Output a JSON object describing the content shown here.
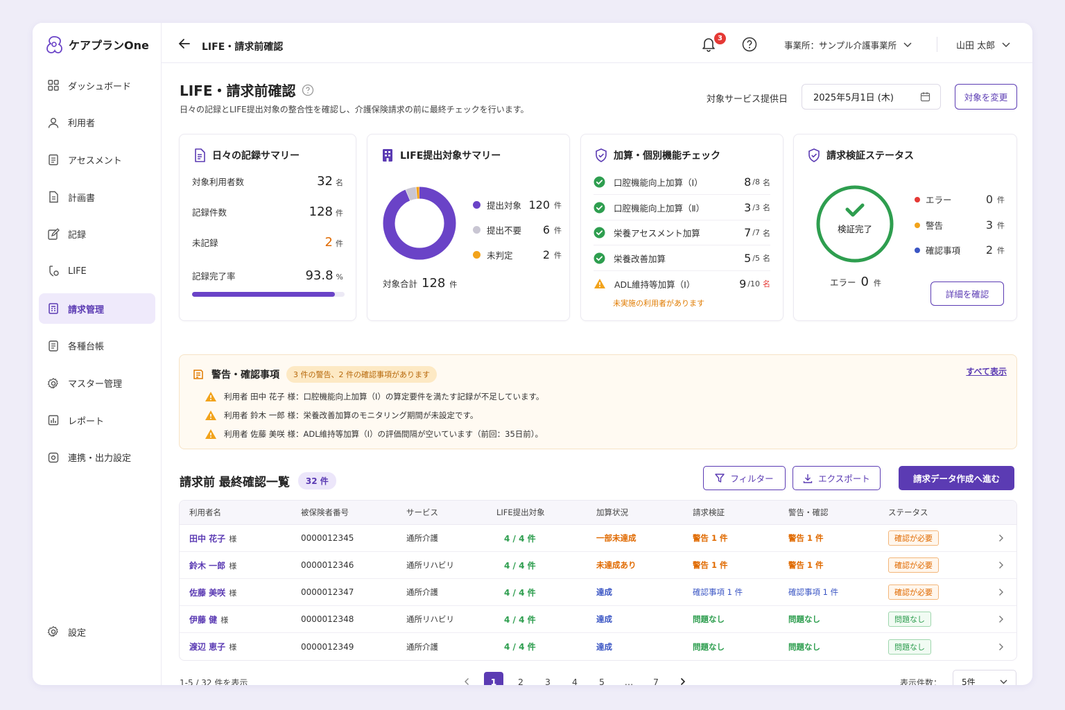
{
  "app": {
    "name": "ケアプランOne"
  },
  "header": {
    "title": "LIFE・請求前確認",
    "notification_count": "3",
    "office": "事業所：サンプル介護事業所",
    "user": "山田 太郎"
  },
  "sidebar": {
    "items": [
      {
        "label": "ダッシュボード",
        "icon": "grid-icon"
      },
      {
        "label": "利用者",
        "icon": "user-icon"
      },
      {
        "label": "アセスメント",
        "icon": "clipboard-icon"
      },
      {
        "label": "計画書",
        "icon": "document-icon"
      },
      {
        "label": "記録",
        "icon": "edit-icon"
      },
      {
        "label": "LIFE",
        "icon": "life-icon"
      },
      {
        "label": "請求管理",
        "icon": "billing-icon"
      },
      {
        "label": "各種台帳",
        "icon": "ledger-icon"
      },
      {
        "label": "マスター管理",
        "icon": "gear-icon"
      },
      {
        "label": "レポート",
        "icon": "report-icon"
      },
      {
        "label": "連携・出力設定",
        "icon": "link-settings-icon"
      }
    ],
    "active_index": 6,
    "bottom": {
      "label": "設定",
      "icon": "gear-icon"
    }
  },
  "page": {
    "title": "LIFE・請求前確認",
    "subtitle": "日々の記録とLIFE提出対象の整合性を確認し、介護保険請求の前に最終チェックを行います。",
    "date_label": "対象サービス提供日",
    "date_value": "2025年5月1日 (木)",
    "change_button": "対象を変更"
  },
  "records_card": {
    "title": "日々の記録サマリー",
    "rows": [
      {
        "label": "対象利用者数",
        "value": "32",
        "unit": "名"
      },
      {
        "label": "記録件数",
        "value": "128",
        "unit": "件"
      },
      {
        "label": "未記録",
        "value": "2",
        "unit": "件"
      },
      {
        "label": "記録完了率",
        "value": "93.8",
        "unit": "%"
      }
    ],
    "completion_fraction": 0.938
  },
  "life_card": {
    "title": "LIFE提出対象サマリー",
    "legend": [
      {
        "label": "提出対象",
        "value": "120",
        "unit": "件",
        "color": "#6a43c7"
      },
      {
        "label": "提出不要",
        "value": "6",
        "unit": "件",
        "color": "#c9c6d3"
      },
      {
        "label": "未判定",
        "value": "2",
        "unit": "件",
        "color": "#f2a31b"
      }
    ],
    "total_label": "対象合計",
    "total_value": "128",
    "total_unit": "件"
  },
  "kasan_card": {
    "title": "加算・個別機能チェック",
    "rows": [
      {
        "label": "口腔機能向上加算（Ⅰ）",
        "value": "8",
        "denom": "/8",
        "unit": "名",
        "status": "ok"
      },
      {
        "label": "口腔機能向上加算（Ⅱ）",
        "value": "3",
        "denom": "/3",
        "unit": "名",
        "status": "ok"
      },
      {
        "label": "栄養アセスメント加算",
        "value": "7",
        "denom": "/7",
        "unit": "名",
        "status": "ok"
      },
      {
        "label": "栄養改善加算",
        "value": "5",
        "denom": "/5",
        "unit": "名",
        "status": "ok"
      },
      {
        "label": "ADL維持等加算（Ⅰ）",
        "value": "9",
        "denom": "/10",
        "unit": "名",
        "status": "warn"
      }
    ],
    "warn_note": "未実施の利用者があります"
  },
  "status_card": {
    "title": "請求検証ステータス",
    "center_label": "検証完了",
    "error_label": "エラー",
    "error_value": "0",
    "error_unit": "件",
    "legend": [
      {
        "label": "エラー",
        "value": "0",
        "unit": "件",
        "color": "#e53935"
      },
      {
        "label": "警告",
        "value": "3",
        "unit": "件",
        "color": "#f2a31b"
      },
      {
        "label": "確認事項",
        "value": "2",
        "unit": "件",
        "color": "#3b56c4"
      }
    ],
    "detail_button": "詳細を確認"
  },
  "alerts": {
    "title": "警告・確認事項",
    "pill": "3 件の警告、2 件の確認事項があります",
    "show_all": "すべて表示",
    "items": [
      "利用者 田中 花子 様：口腔機能向上加算（Ⅰ）の算定要件を満たす記録が不足しています。",
      "利用者 鈴木 一郎 様：栄養改善加算のモニタリング期間が未設定です。",
      "利用者 佐藤 美咲 様：ADL維持等加算（Ⅰ）の評価間隔が空いています（前回：35日前）。"
    ]
  },
  "list": {
    "title": "請求前 最終確認一覧",
    "count": "32 件",
    "filter_button": "フィルター",
    "export_button": "エクスポート",
    "primary_button": "請求データ作成へ進む",
    "columns": [
      "利用者名",
      "被保険者番号",
      "サービス",
      "LIFE提出対象",
      "加算状況",
      "請求検証",
      "警告・確認",
      "ステータス"
    ],
    "rows": [
      {
        "name": "田中 花子",
        "sama": "様",
        "number": "0000012345",
        "service": "通所介護",
        "life": "4 / 4 件",
        "kasan": "一部未達成",
        "kasan_type": "o",
        "verify": "警告 1 件",
        "verify_type": "o",
        "warn": "警告 1 件",
        "warn_type": "o",
        "status": "確認が必要",
        "status_type": "o"
      },
      {
        "name": "鈴木 一郎",
        "sama": "様",
        "number": "0000012346",
        "service": "通所リハビリ",
        "life": "4 / 4 件",
        "kasan": "未達成あり",
        "kasan_type": "o",
        "verify": "警告 1 件",
        "verify_type": "o",
        "warn": "警告 1 件",
        "warn_type": "o",
        "status": "確認が必要",
        "status_type": "o"
      },
      {
        "name": "佐藤 美咲",
        "sama": "様",
        "number": "0000012347",
        "service": "通所介護",
        "life": "4 / 4 件",
        "kasan": "達成",
        "kasan_type": "b",
        "verify": "確認事項 1 件",
        "verify_type": "b",
        "warn": "確認事項 1 件",
        "warn_type": "b",
        "status": "確認が必要",
        "status_type": "o"
      },
      {
        "name": "伊藤 健",
        "sama": "様",
        "number": "0000012348",
        "service": "通所リハビリ",
        "life": "4 / 4 件",
        "kasan": "達成",
        "kasan_type": "b",
        "verify": "問題なし",
        "verify_type": "g",
        "warn": "問題なし",
        "warn_type": "g",
        "status": "問題なし",
        "status_type": "g"
      },
      {
        "name": "渡辺 恵子",
        "sama": "様",
        "number": "0000012349",
        "service": "通所介護",
        "life": "4 / 4 件",
        "kasan": "達成",
        "kasan_type": "b",
        "verify": "問題なし",
        "verify_type": "g",
        "warn": "問題なし",
        "warn_type": "g",
        "status": "問題なし",
        "status_type": "g"
      }
    ]
  },
  "pagination": {
    "info": "1-5 / 32 件を表示",
    "pages": [
      "1",
      "2",
      "3",
      "4",
      "5",
      "…",
      "7"
    ],
    "current": "1",
    "per_page_label": "表示件数：",
    "per_page_value": "5件"
  },
  "colors": {
    "accent": "#5b3bb3",
    "success": "#2e9e4f",
    "warning": "#e06a00",
    "info": "#3b56c4",
    "error": "#e53935"
  }
}
